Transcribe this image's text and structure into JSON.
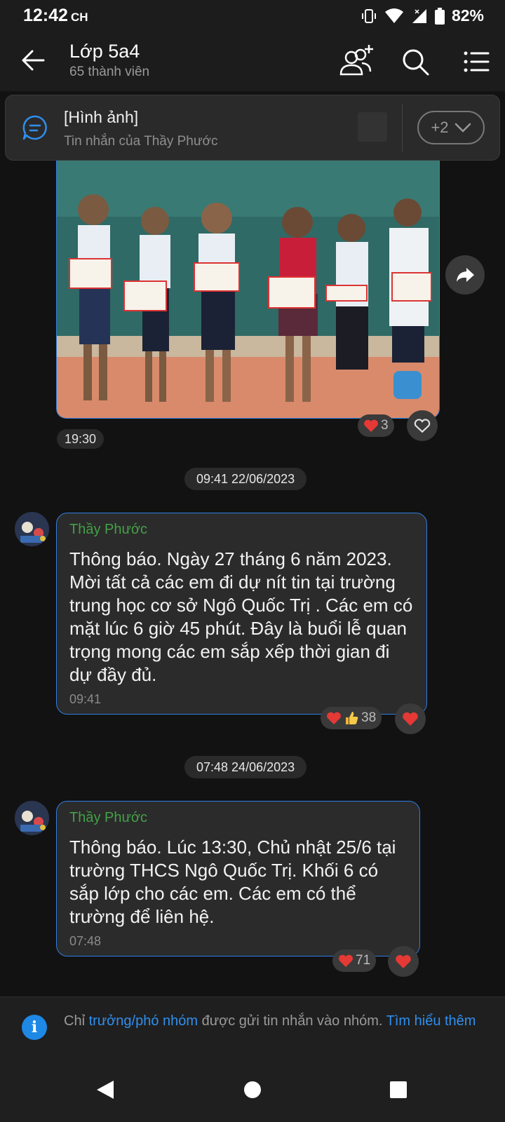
{
  "status": {
    "time": "12:42",
    "ampm": "CH",
    "battery": "82%"
  },
  "header": {
    "title": "Lớp 5a4",
    "subtitle": "65 thành viên"
  },
  "pinned": {
    "title": "[Hình ảnh]",
    "subtitle": "Tin nhắn của Thầy Phước",
    "more": "+2"
  },
  "photo_message": {
    "time": "19:30",
    "reaction_count": "3"
  },
  "messages": [
    {
      "date": "09:41 22/06/2023",
      "sender": "Thầy Phước",
      "text": "Thông báo. Ngày 27 tháng 6 năm 2023. Mời tất cả các em đi dự nít tin tại trường trung học cơ sở Ngô Quốc Trị . Các em có mặt lúc 6 giờ 45 phút. Đây là buổi lễ quan trọng mong các em sắp xếp thời gian đi dự đầy đủ.",
      "time": "09:41",
      "reaction_count": "38"
    },
    {
      "date": "07:48 24/06/2023",
      "sender": "Thầy Phước",
      "text": "Thông báo. Lúc 13:30, Chủ nhật 25/6 tại trường THCS Ngô Quốc Trị. Khối 6 có sắp lớp cho các em. Các em có thể trường để liên hệ.",
      "time": "07:48",
      "reaction_count": "71"
    }
  ],
  "notice": {
    "prefix": "Chỉ ",
    "link1": "trưởng/phó nhóm",
    "middle": " được gửi tin nhắn vào nhóm. ",
    "link2": "Tìm hiểu thêm"
  },
  "colors": {
    "accent": "#2f7de1",
    "sender": "#43a047",
    "heart": "#e53935"
  }
}
